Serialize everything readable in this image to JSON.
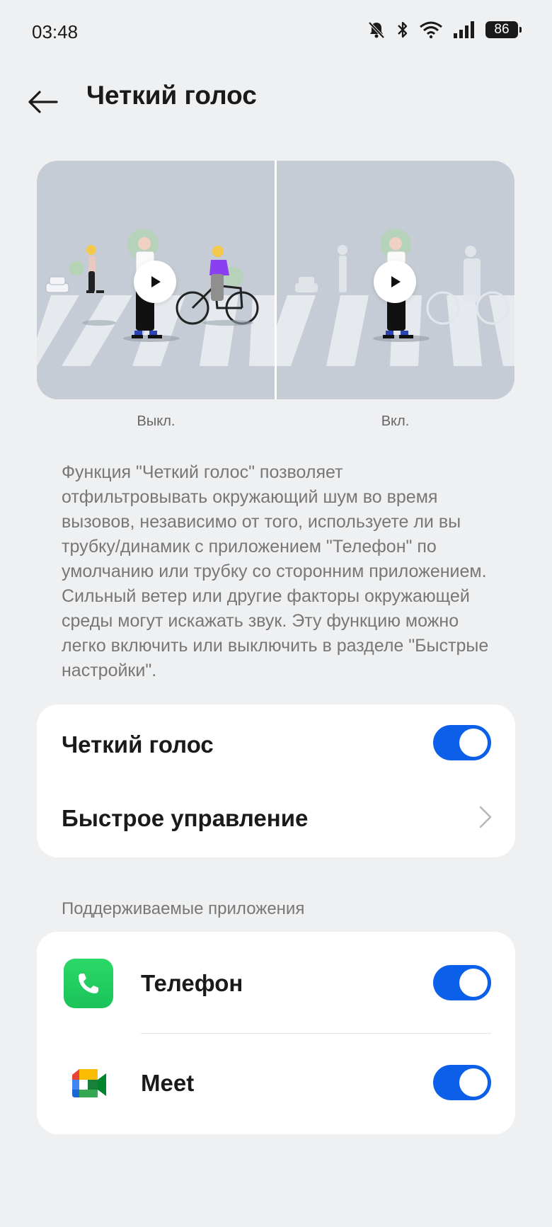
{
  "status_bar": {
    "time": "03:48",
    "battery": "86",
    "icons": [
      "mute-bell-icon",
      "bluetooth-icon",
      "wifi-icon",
      "signal-icon",
      "battery-icon"
    ]
  },
  "header": {
    "title": "Четкий голос",
    "back_icon": "back-arrow-icon"
  },
  "preview": {
    "off_caption": "Выкл.",
    "on_caption": "Вкл."
  },
  "description": "Функция \"Четкий голос\" позволяет отфильтровывать окружающий шум во время вызовов, независимо от того, используете ли вы трубку/динамик с приложением \"Телефон\" по умолчанию или трубку со сторонним приложением. Сильный ветер или другие факторы окружающей среды могут искажать звук. Эту функцию можно легко включить или выключить в разделе \"Быстрые настройки\".",
  "settings": {
    "clear_voice": {
      "label": "Четкий голос",
      "enabled": true
    },
    "quick_control": {
      "label": "Быстрое управление"
    }
  },
  "supported_apps": {
    "section_label": "Поддерживаемые приложения",
    "apps": [
      {
        "name": "Телефон",
        "icon": "phone-app-icon",
        "enabled": true
      },
      {
        "name": "Meet",
        "icon": "meet-app-icon",
        "enabled": true
      }
    ]
  },
  "colors": {
    "accent": "#0b5fe8",
    "background": "#eff0f2",
    "card": "#ffffff"
  }
}
